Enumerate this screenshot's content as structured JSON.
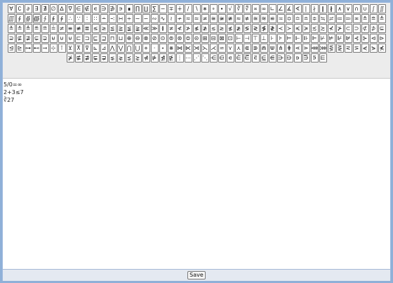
{
  "toolbar": {
    "symbols": [
      "∀",
      "∁",
      "∂",
      "∃",
      "∄",
      "∅",
      "∆",
      "∇",
      "∈",
      "∉",
      "∊",
      "∋",
      "∌",
      "∍",
      "∎",
      "∏",
      "∐",
      "∑",
      "−",
      "∓",
      "∔",
      "∕",
      "∖",
      "∗",
      "∘",
      "∙",
      "√",
      "∛",
      "∜",
      "∝",
      "∞",
      "∟",
      "∠",
      "∡",
      "∢",
      "∣",
      "∤",
      "∥",
      "∦",
      "∧",
      "∨",
      "∩",
      "∪",
      "∫",
      "∬",
      "∭",
      "∮",
      "∯",
      "∰",
      "∱",
      "∲",
      "∳",
      "∴",
      "∵",
      "∶",
      "∷",
      "∸",
      "∹",
      "∺",
      "∻",
      "∼",
      "∽",
      "∾",
      "∿",
      "≀",
      "≁",
      "≂",
      "≃",
      "≄",
      "≅",
      "≆",
      "≇",
      "≈",
      "≉",
      "≊",
      "≋",
      "≌",
      "≍",
      "≎",
      "≏",
      "≐",
      "≑",
      "≒",
      "≓",
      "≔",
      "≕",
      "≖",
      "≗",
      "≘",
      "≙",
      "≚",
      "≛",
      "≜",
      "≝",
      "≞",
      "≟",
      "≠",
      "≡",
      "≢",
      "≣",
      "≤",
      "≥",
      "≦",
      "≧",
      "≨",
      "≩",
      "≪",
      "≫",
      "≬",
      "≭",
      "≮",
      "≯",
      "≰",
      "≱",
      "≲",
      "≳",
      "≴",
      "≵",
      "≶",
      "≷",
      "≸",
      "≹",
      "≺",
      "≻",
      "≼",
      "≽",
      "≾",
      "≿",
      "⊀",
      "⊁",
      "⊂",
      "⊃",
      "⊄",
      "⊅",
      "⊆",
      "⊇",
      "⊈",
      "⊉",
      "⊊",
      "⊋",
      "⊌",
      "⊍",
      "⊎",
      "⊏",
      "⊐",
      "⊑",
      "⊒",
      "⊓",
      "⊔",
      "⊕",
      "⊖",
      "⊗",
      "⊘",
      "⊙",
      "⊚",
      "⊛",
      "⊜",
      "⊝",
      "⊞",
      "⊟",
      "⊠",
      "⊡",
      "⊢",
      "⊣",
      "⊤",
      "⊥",
      "⊦",
      "⊧",
      "⊨",
      "⊩",
      "⊪",
      "⊫",
      "⊬",
      "⊭",
      "⊮",
      "⊯",
      "⊰",
      "⊱",
      "⊲",
      "⊳",
      "⊴",
      "⊵",
      "⊶",
      "⊷",
      "⊸",
      "⊹",
      "⊺",
      "⊻",
      "⊼",
      "⊽",
      "⊾",
      "⊿",
      "⋀",
      "⋁",
      "⋂",
      "⋃",
      "⋄",
      "⋅",
      "⋆",
      "⋇",
      "⋈",
      "⋉",
      "⋊",
      "⋋",
      "⋌",
      "⋍",
      "⋎",
      "⋏",
      "⋐",
      "⋑",
      "⋒",
      "⋓",
      "⋔",
      "⋕",
      "⋖",
      "⋗",
      "⋘",
      "⋙",
      "⋚",
      "⋛",
      "⋜",
      "⋝",
      "⋞",
      "⋟",
      "⋠",
      "⋡",
      "⋢",
      "⋣",
      "⋤",
      "⋥",
      "⋦",
      "⋧",
      "⋨",
      "⋩",
      "⋪",
      "⋫",
      "⋬",
      "⋭",
      "⋮",
      "⋯",
      "⋰",
      "⋱",
      "⋲",
      "⋳",
      "⋴",
      "⋵",
      "⋶",
      "⋷",
      "⋸",
      "⋹",
      "⋺",
      "⋻",
      "⋼",
      "⋽",
      "⋾",
      "⋿"
    ]
  },
  "editor": {
    "lines": [
      "5/0=∞",
      "2+3≤7",
      "∛27"
    ]
  },
  "footer": {
    "save_label": "Save"
  }
}
